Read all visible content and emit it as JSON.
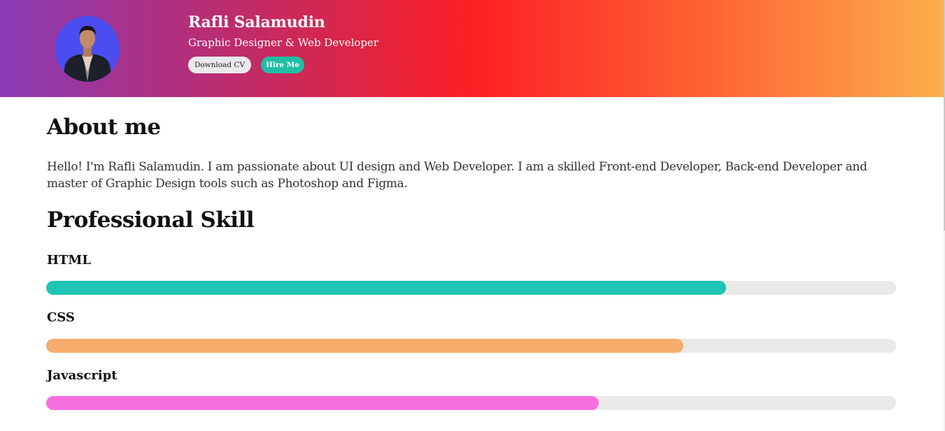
{
  "header": {
    "name": "Rafli Salamudin",
    "role": "Graphic Designer & Web Developer",
    "download_cv_label": "Download CV",
    "hire_me_label": "Hire Me",
    "avatar_bg_color": "#4a4df0",
    "hire_color": "#1fbfa5"
  },
  "about": {
    "heading": "About me",
    "text": "Hello! I'm Rafli Salamudin. I am passionate about UI design and Web Developer. I am a skilled Front-end Developer, Back-end Developer and master of Graphic Design tools such as Photoshop and Figma."
  },
  "skills": {
    "heading": "Professional Skill",
    "items": [
      {
        "label": "HTML",
        "percent": 80,
        "color": "#1fc4b4"
      },
      {
        "label": "CSS",
        "percent": 75,
        "color": "#f5ac6c"
      },
      {
        "label": "Javascript",
        "percent": 65,
        "color": "#f570de"
      }
    ]
  }
}
